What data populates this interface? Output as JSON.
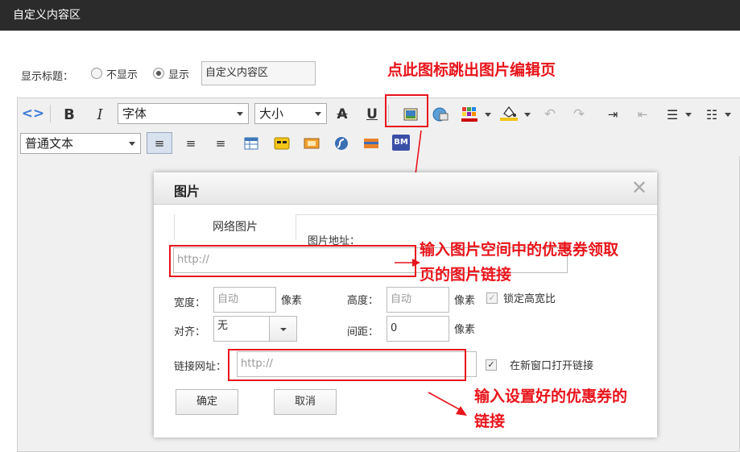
{
  "window": {
    "title": "自定义内容区"
  },
  "show_title": {
    "label": "显示标题：",
    "option_hide": "不显示",
    "option_show": "显示",
    "selected": "显示",
    "value": "自定义内容区"
  },
  "toolbar": {
    "bold": "B",
    "italic": "I",
    "font_select": "字体",
    "size_select": "大小",
    "strike": "A",
    "underline": "U",
    "format_select": "普通文本",
    "bm": "BM",
    "text_color": "#cc0000",
    "bg_color": "#f0c419"
  },
  "annotations": {
    "image_icon_note": "点此图标跳出图片编辑页",
    "image_url_note_line1": "输入图片空间中的优惠券领取",
    "image_url_note_line2": "页的图片链接",
    "link_url_note_line1": "输入设置好的优惠券的",
    "link_url_note_line2": "链接",
    "color": "#e8141b"
  },
  "dialog": {
    "title": "图片",
    "close": "✕",
    "tab_web_image": "网络图片",
    "image_url_label": "图片地址：",
    "image_url_placeholder": "http://",
    "width_label": "宽度：",
    "width_placeholder": "自动",
    "width_unit": "像素",
    "height_label": "高度：",
    "height_placeholder": "自动",
    "height_unit": "像素",
    "lock_ratio_label": "锁定高宽比",
    "lock_ratio_checked": true,
    "align_label": "对齐：",
    "align_value": "无",
    "spacing_label": "间距：",
    "spacing_value": "0",
    "spacing_unit": "像素",
    "link_url_label": "链接网址：",
    "link_url_placeholder": "http://",
    "new_window_label": "在新窗口打开链接",
    "new_window_checked": true,
    "ok_button": "确定",
    "cancel_button": "取消"
  }
}
